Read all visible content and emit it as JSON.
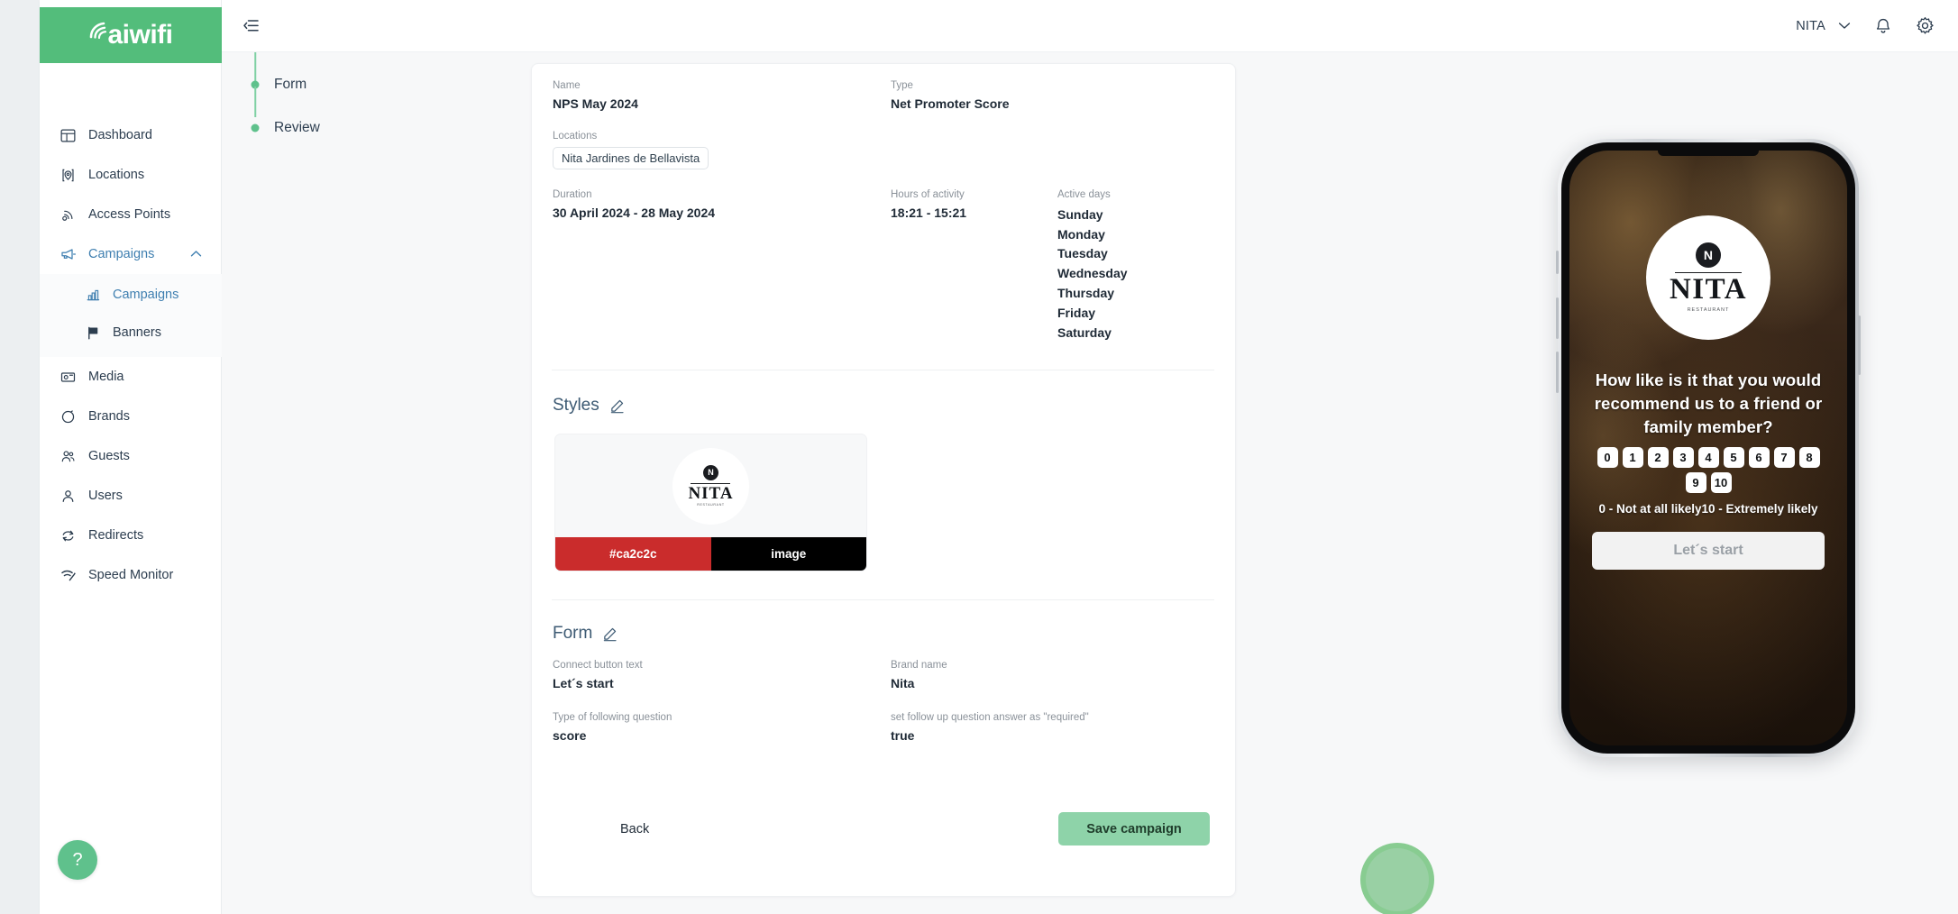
{
  "brand": {
    "logo_text": "aiwifi",
    "logo_bg": "#53bd7b"
  },
  "sidebar": {
    "items": [
      {
        "label": "Dashboard",
        "icon": "dashboard-icon"
      },
      {
        "label": "Locations",
        "icon": "location-pin-icon"
      },
      {
        "label": "Access Points",
        "icon": "access-point-icon"
      },
      {
        "label": "Campaigns",
        "icon": "megaphone-icon",
        "active": true,
        "expanded": true
      },
      {
        "label": "Media",
        "icon": "media-icon"
      },
      {
        "label": "Brands",
        "icon": "brands-icon"
      },
      {
        "label": "Guests",
        "icon": "guests-icon"
      },
      {
        "label": "Users",
        "icon": "user-icon"
      },
      {
        "label": "Redirects",
        "icon": "redirects-icon"
      },
      {
        "label": "Speed Monitor",
        "icon": "speed-monitor-icon"
      }
    ],
    "submenu": [
      {
        "label": "Campaigns",
        "icon": "bar-chart-icon",
        "active": true
      },
      {
        "label": "Banners",
        "icon": "flag-icon",
        "active": false
      }
    ],
    "help_label": "?"
  },
  "topbar": {
    "menu_icon": "collapse-menu-icon",
    "account_name": "NITA",
    "chevron": "chevron-down-icon",
    "bell": "bell-icon",
    "gear": "gear-icon"
  },
  "stepper": {
    "steps": [
      {
        "label": "Form"
      },
      {
        "label": "Review"
      }
    ]
  },
  "review": {
    "name_label": "Name",
    "name_value": "NPS May 2024",
    "type_label": "Type",
    "type_value": "Net Promoter Score",
    "locations_label": "Locations",
    "locations_chips": [
      "Nita Jardines de Bellavista"
    ],
    "duration_label": "Duration",
    "duration_value": "30 April 2024 - 28 May 2024",
    "hours_label": "Hours of activity",
    "hours_value": "18:21 - 15:21",
    "active_days_label": "Active days",
    "active_days": [
      "Sunday",
      "Monday",
      "Tuesday",
      "Wednesday",
      "Thursday",
      "Friday",
      "Saturday"
    ]
  },
  "styles_section": {
    "title": "Styles",
    "edit_icon": "pencil-icon",
    "color_hex": "#ca2c2c",
    "color_label": "#ca2c2c",
    "image_label": "image",
    "image_cell_bg": "#000000"
  },
  "form_section": {
    "title": "Form",
    "edit_icon": "pencil-icon",
    "connect_button_text_label": "Connect button text",
    "connect_button_text_value": "Let´s start",
    "brand_name_label": "Brand name",
    "brand_name_value": "Nita",
    "question_type_label": "Type of following question",
    "question_type_value": "score",
    "required_label": "set follow up question answer as \"required\"",
    "required_value": "true"
  },
  "footer": {
    "back_label": "Back",
    "save_label": "Save campaign",
    "save_bg": "#8ed3a9"
  },
  "preview": {
    "logo": {
      "badge_letter": "N",
      "name": "NITA",
      "sub": "RESTAURANT"
    },
    "question": "How like is it that you would recommend us to a friend or family member?",
    "scores": [
      "0",
      "1",
      "2",
      "3",
      "4",
      "5",
      "6",
      "7",
      "8",
      "9",
      "10"
    ],
    "legend": "0 - Not at all likely10 - Extremely likely",
    "cta_label": "Let´s start"
  }
}
